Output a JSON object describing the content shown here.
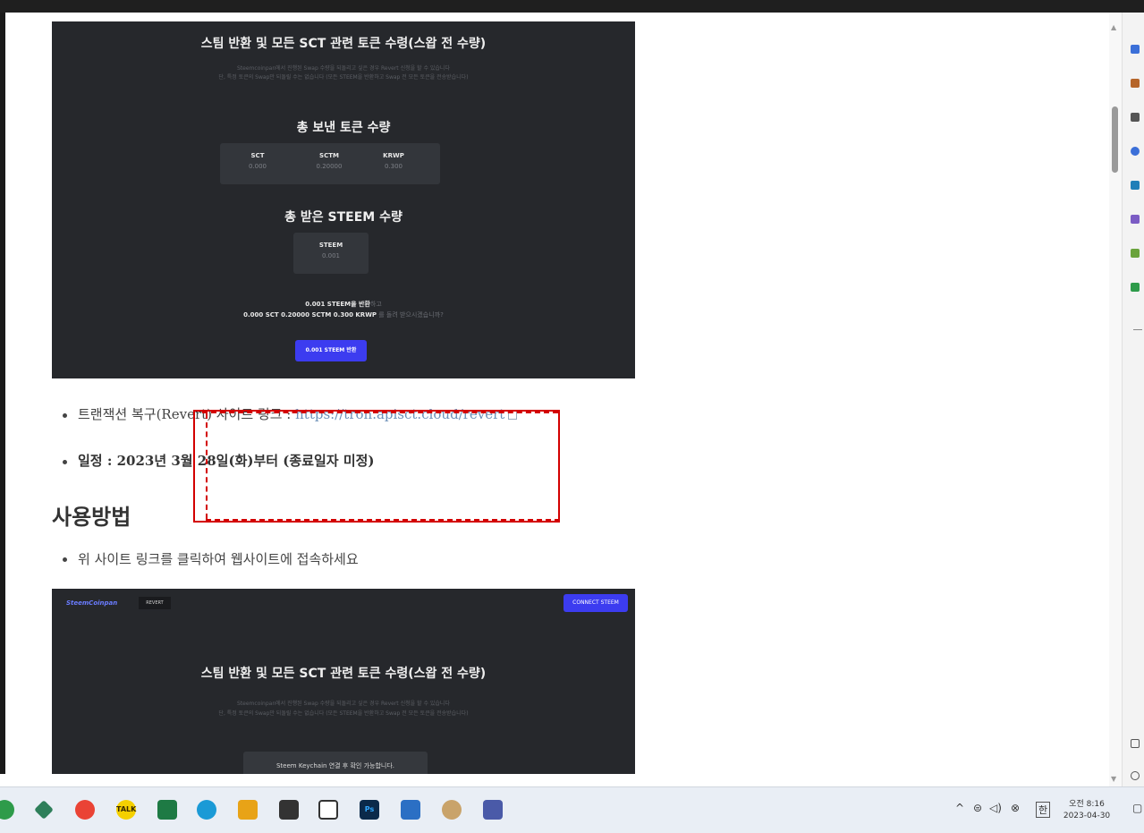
{
  "shot1": {
    "title": "스팀 반환 및 모든 SCT 관련 토큰 수령(스왑 전 수량)",
    "sub1": "Steemcoinpan에서 진행된 Swap 수량을 되돌리고 싶은 경우 Revert 신청을 할 수 있습니다",
    "sub2": "단, 특정 토큰의 Swap만 되돌릴 수는 없습니다 (모든 STEEM을 반환하고 Swap 전 모든 토큰을 전송받습니다)",
    "sent_heading": "총 보낸 토큰 수량",
    "sent": [
      {
        "label": "SCT",
        "value": "0.000"
      },
      {
        "label": "SCTM",
        "value": "0.20000"
      },
      {
        "label": "KRWP",
        "value": "0.300"
      }
    ],
    "recv_heading": "총 받은 STEEM 수량",
    "recv": {
      "label": "STEEM",
      "value": "0.001"
    },
    "note1_bold": "0.001 STEEM을 반환",
    "note1_rest": "하고",
    "note2_bold": "0.000 SCT 0.20000 SCTM 0.300 KRWP",
    "note2_rest": " 를 돌려 받으시겠습니까?",
    "button": "0.001 STEEM 반환"
  },
  "bullets": {
    "revert_label": "트랜잭션 복구(Revert) 사이트 링크 : ",
    "revert_link": "https://tron.apisct.cloud/revert",
    "schedule": "일정 : 2023년 3월 28일(화)부터 (종료일자 미정)"
  },
  "usage": {
    "heading": "사용방법",
    "step1": "위 사이트 링크를 클릭하여 웹사이트에 접속하세요"
  },
  "shot2": {
    "logo": "SteemCoinpan",
    "tag": "REVERT",
    "connect": "CONNECT STEEM",
    "title": "스팀 반환 및 모든 SCT 관련 토큰 수령(스왑 전 수량)",
    "sub1": "Steemcoinpan에서 진행된 Swap 수량을 되돌리고 싶은 경우 Revert 신청을 할 수 있습니다",
    "sub2": "단, 특정 토큰의 Swap만 되돌릴 수는 없습니다 (모든 STEEM을 반환하고 Swap 전 모든 토큰을 전송받습니다)",
    "keychain": "Steem Keychain 연결 후 확인 가능합니다."
  },
  "taskbar": {
    "talk": "TALK",
    "ps": "Ps",
    "tray_ime": "한",
    "time": "오전 8:16",
    "date": "2023-04-30"
  },
  "colors": {
    "accent_blue": "#3c3cf0",
    "highlight_red": "#d30000",
    "shot_bg": "#26282c"
  }
}
